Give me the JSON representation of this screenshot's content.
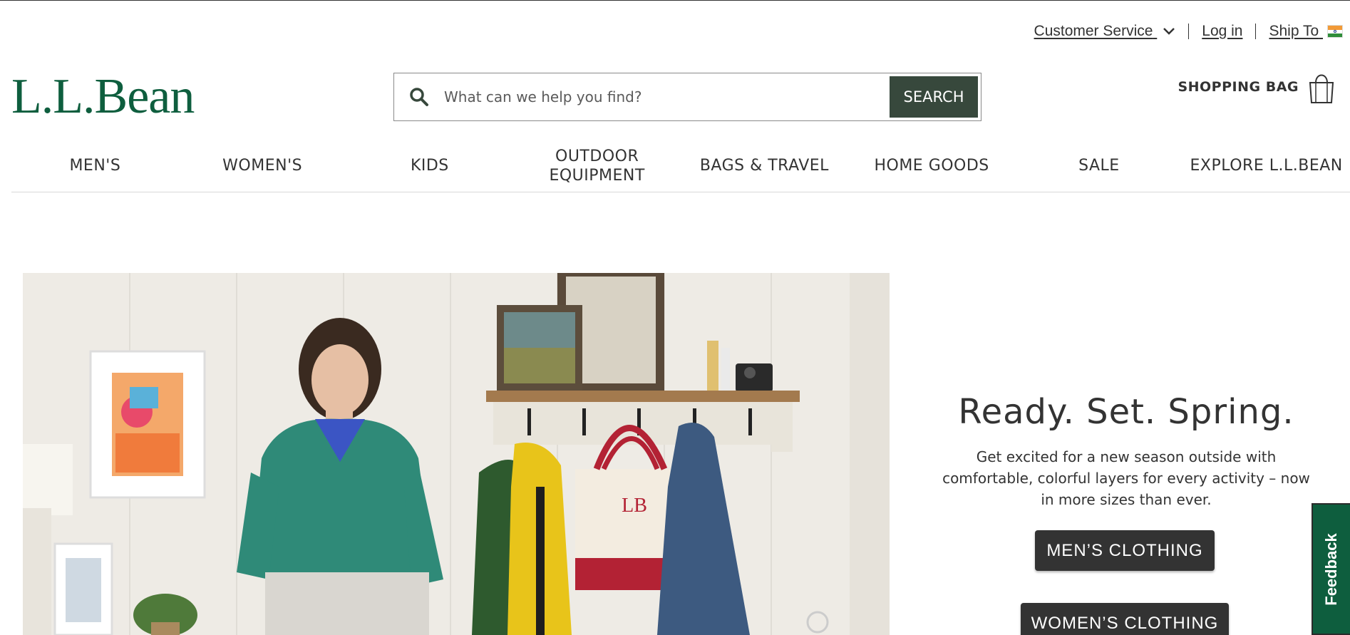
{
  "utility": {
    "customer_service": "Customer Service",
    "login": "Log in ",
    "ship_to": "Ship To"
  },
  "header": {
    "logo": "L.L.Bean",
    "search_placeholder": "What can we help you find?",
    "search_button": "SEARCH",
    "shopping_bag": "SHOPPING BAG"
  },
  "nav": {
    "items": [
      {
        "label": "MEN'S"
      },
      {
        "label": "WOMEN'S"
      },
      {
        "label": "KIDS"
      },
      {
        "label": "OUTDOOR EQUIPMENT"
      },
      {
        "label": "BAGS & TRAVEL"
      },
      {
        "label": "HOME GOODS"
      },
      {
        "label": "SALE"
      },
      {
        "label": "EXPLORE L.L.BEAN"
      }
    ]
  },
  "hero": {
    "headline": "Ready. Set. Spring.",
    "body": "Get excited for a new season outside with comfortable, colorful layers for every activity – now in more sizes than ever.",
    "mens_button": "MEN’S CLOTHING",
    "womens_button": "WOMEN’S CLOTHING",
    "tote_monogram": "LB"
  },
  "feedback": {
    "label": "Feedback"
  },
  "colors": {
    "brand_green": "#0e5e3e",
    "search_button": "#37483c",
    "dark_button": "#333333"
  }
}
